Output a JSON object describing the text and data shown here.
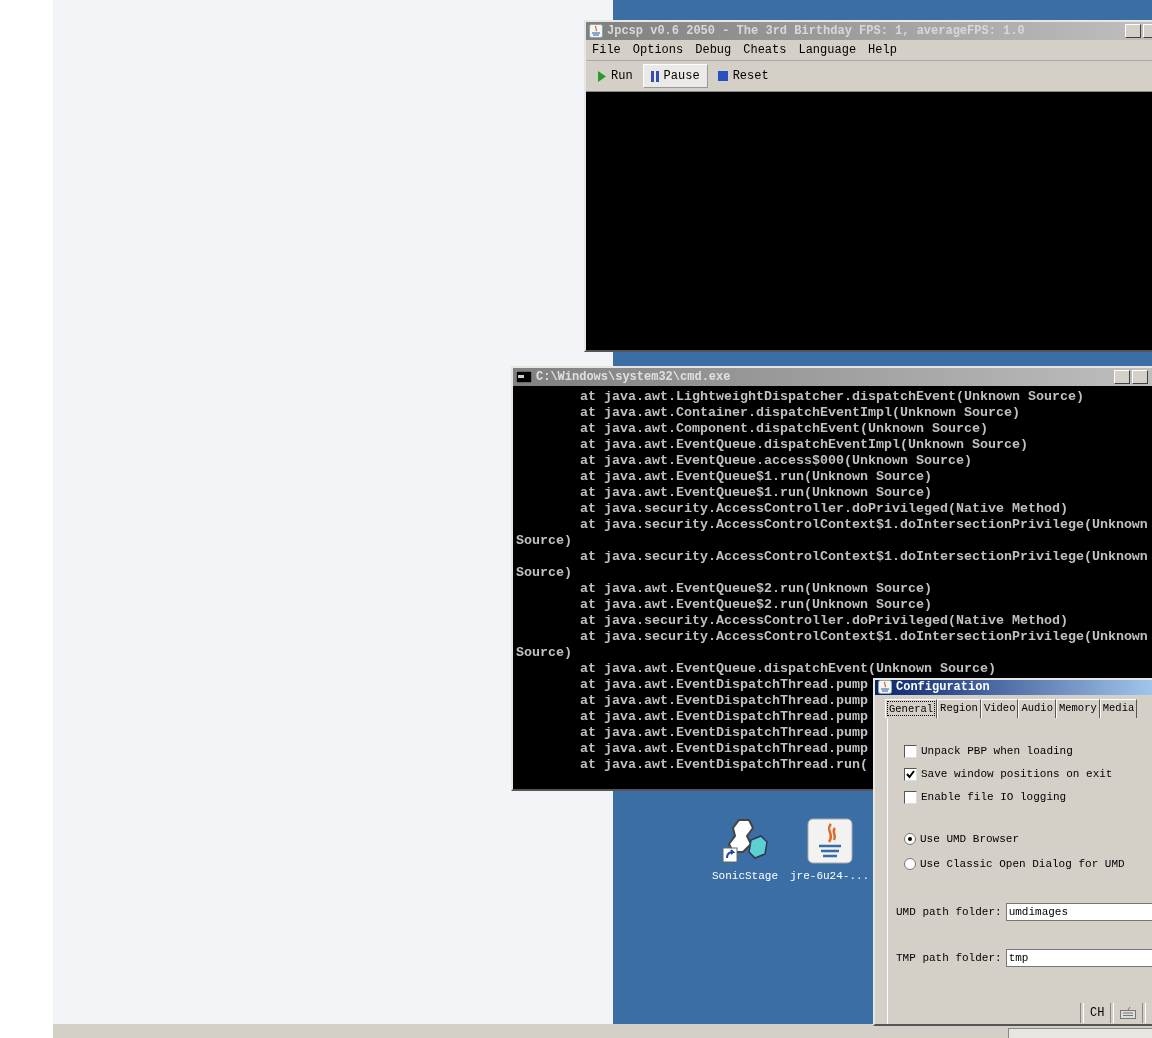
{
  "desktop": {
    "icons": [
      {
        "label": "SonicStage",
        "kind": "sonicstage"
      },
      {
        "label": "jre-6u24-...",
        "kind": "java"
      }
    ]
  },
  "emulator_window": {
    "title": "Jpcsp v0.6 2050 - The 3rd Birthday FPS: 1, averageFPS: 1.0",
    "menu": [
      "File",
      "Options",
      "Debug",
      "Cheats",
      "Language",
      "Help"
    ],
    "toolbar": [
      {
        "label": "Run",
        "kind": "run",
        "selected": false
      },
      {
        "label": "Pause",
        "kind": "pause",
        "selected": true
      },
      {
        "label": "Reset",
        "kind": "reset",
        "selected": false
      }
    ]
  },
  "console_window": {
    "title": "C:\\Windows\\system32\\cmd.exe",
    "lines": [
      {
        "text": "at java.awt.LightweightDispatcher.dispatchEvent(Unknown Source)",
        "kind": "frame"
      },
      {
        "text": "at java.awt.Container.dispatchEventImpl(Unknown Source)",
        "kind": "frame"
      },
      {
        "text": "at java.awt.Component.dispatchEvent(Unknown Source)",
        "kind": "frame"
      },
      {
        "text": "at java.awt.EventQueue.dispatchEventImpl(Unknown Source)",
        "kind": "frame"
      },
      {
        "text": "at java.awt.EventQueue.access$000(Unknown Source)",
        "kind": "frame"
      },
      {
        "text": "at java.awt.EventQueue$1.run(Unknown Source)",
        "kind": "frame"
      },
      {
        "text": "at java.awt.EventQueue$1.run(Unknown Source)",
        "kind": "frame"
      },
      {
        "text": "at java.security.AccessController.doPrivileged(Native Method)",
        "kind": "frame"
      },
      {
        "text": "at java.security.AccessControlContext$1.doIntersectionPrivilege(Unknown",
        "kind": "frame"
      },
      {
        "text": "Source)",
        "kind": "wrap"
      },
      {
        "text": "at java.security.AccessControlContext$1.doIntersectionPrivilege(Unknown",
        "kind": "frame"
      },
      {
        "text": "Source)",
        "kind": "wrap"
      },
      {
        "text": "at java.awt.EventQueue$2.run(Unknown Source)",
        "kind": "frame"
      },
      {
        "text": "at java.awt.EventQueue$2.run(Unknown Source)",
        "kind": "frame"
      },
      {
        "text": "at java.security.AccessController.doPrivileged(Native Method)",
        "kind": "frame"
      },
      {
        "text": "at java.security.AccessControlContext$1.doIntersectionPrivilege(Unknown",
        "kind": "frame"
      },
      {
        "text": "Source)",
        "kind": "wrap"
      },
      {
        "text": "at java.awt.EventQueue.dispatchEvent(Unknown Source)",
        "kind": "frame"
      },
      {
        "text": "at java.awt.EventDispatchThread.pump",
        "kind": "frame"
      },
      {
        "text": "at java.awt.EventDispatchThread.pump",
        "kind": "frame"
      },
      {
        "text": "at java.awt.EventDispatchThread.pump",
        "kind": "frame"
      },
      {
        "text": "at java.awt.EventDispatchThread.pump",
        "kind": "frame"
      },
      {
        "text": "at java.awt.EventDispatchThread.pump",
        "kind": "frame"
      },
      {
        "text": "at java.awt.EventDispatchThread.run(",
        "kind": "frame"
      }
    ]
  },
  "config_window": {
    "title": "Configuration",
    "tabs": [
      {
        "label": "General",
        "selected": true
      },
      {
        "label": "Region",
        "selected": false
      },
      {
        "label": "Video",
        "selected": false
      },
      {
        "label": "Audio",
        "selected": false
      },
      {
        "label": "Memory",
        "selected": false
      },
      {
        "label": "Media",
        "selected": false
      }
    ],
    "checkboxes": [
      {
        "label": "Unpack PBP when loading",
        "checked": false
      },
      {
        "label": "Save window positions on exit",
        "checked": true
      },
      {
        "label": "Enable file IO logging",
        "checked": false
      }
    ],
    "radios": [
      {
        "label": "Use UMD Browser",
        "selected": true
      },
      {
        "label": "Use Classic Open Dialog for UMD",
        "selected": false
      }
    ],
    "fields": [
      {
        "label": "UMD path folder:",
        "value": "umdimages"
      },
      {
        "label": "TMP path folder:",
        "value": "tmp"
      }
    ]
  },
  "language_bar": {
    "label": "CH"
  }
}
